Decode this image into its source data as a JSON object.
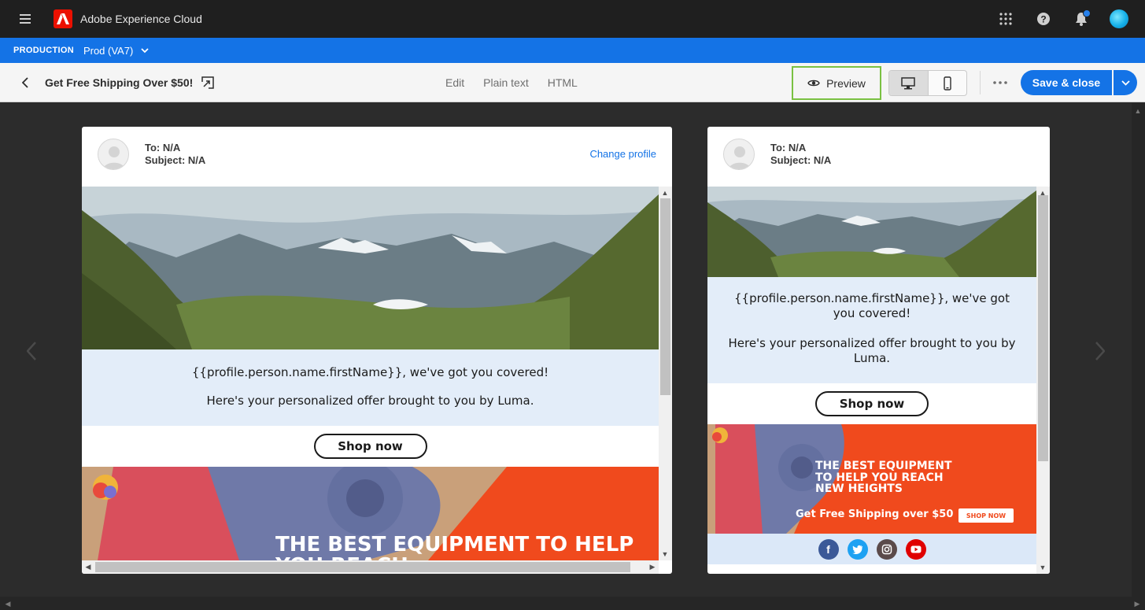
{
  "app": {
    "title": "Adobe Experience Cloud",
    "icons": [
      "menu-icon",
      "adobe-logo",
      "apps-grid-icon",
      "help-icon",
      "notifications-bell-icon",
      "user-avatar"
    ]
  },
  "org": {
    "label": "PRODUCTION",
    "sandbox": "Prod (VA7)"
  },
  "toolbar": {
    "message_title": "Get Free Shipping Over $50!",
    "modes": [
      "Edit",
      "Plain text",
      "HTML"
    ],
    "preview_label": "Preview",
    "save_label": "Save & close",
    "preview_highlight_color": "#7ac142"
  },
  "desktop_preview": {
    "to": "To: N/A",
    "subject": "Subject: N/A",
    "change_profile": "Change profile",
    "greeting": "{{profile.person.name.firstName}}, we've got you covered!",
    "offer": "Here's your personalized offer brought to you by Luma.",
    "cta": "Shop now",
    "banner_headline": "THE BEST EQUIPMENT TO HELP YOU REACH"
  },
  "mobile_preview": {
    "to": "To: N/A",
    "subject": "Subject: N/A",
    "greeting": "{{profile.person.name.firstName}}, we've got you covered!",
    "offer": "Here's your personalized offer brought to you by Luma.",
    "cta": "Shop now",
    "banner_headline_1": "THE BEST EQUIPMENT",
    "banner_headline_2": "TO HELP YOU REACH",
    "banner_headline_3": "NEW HEIGHTS",
    "banner_subline": "Get Free Shipping over $50",
    "banner_button": "SHOP NOW",
    "social": [
      {
        "name": "facebook",
        "glyph": "f",
        "color": "#3b5998"
      },
      {
        "name": "twitter",
        "glyph": "t",
        "color": "#1da1f2"
      },
      {
        "name": "instagram",
        "glyph": "◎",
        "color": "#5b4b4b"
      },
      {
        "name": "youtube",
        "glyph": "▶",
        "color": "#e00000"
      }
    ]
  },
  "colors": {
    "brand_blue": "#1473e6",
    "banner_orange": "#f04a1d",
    "greeting_bg": "#e3edf9"
  }
}
